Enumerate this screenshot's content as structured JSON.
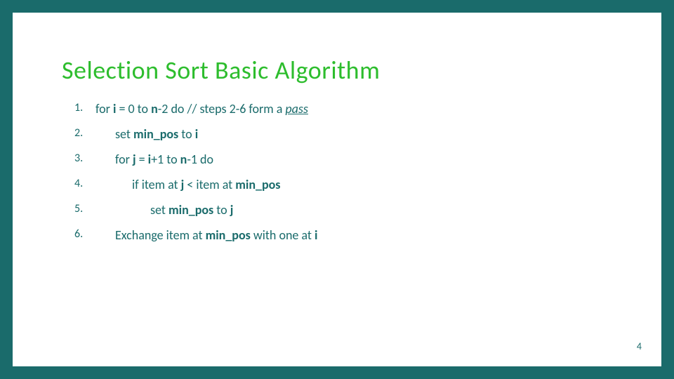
{
  "slide": {
    "title": "Selection Sort Basic Algorithm",
    "page_number": "4",
    "steps": [
      {
        "num": "1.",
        "indent": 1,
        "parts": [
          {
            "t": "for ",
            "b": false
          },
          {
            "t": "i",
            "b": true
          },
          {
            "t": " = 0 to ",
            "b": false
          },
          {
            "t": "n",
            "b": true
          },
          {
            "t": "-2 do   // steps 2-6 form a ",
            "b": false
          },
          {
            "t": "pass",
            "b": false,
            "u": true,
            "i": true
          }
        ]
      },
      {
        "num": "2.",
        "indent": 2,
        "parts": [
          {
            "t": "set ",
            "b": false
          },
          {
            "t": "min_pos",
            "b": true
          },
          {
            "t": " to ",
            "b": false
          },
          {
            "t": "i",
            "b": true
          }
        ]
      },
      {
        "num": "3.",
        "indent": 2,
        "parts": [
          {
            "t": "for ",
            "b": false
          },
          {
            "t": "j",
            "b": true
          },
          {
            "t": " = ",
            "b": false
          },
          {
            "t": "i",
            "b": true
          },
          {
            "t": "+1 to ",
            "b": false
          },
          {
            "t": "n",
            "b": true
          },
          {
            "t": "-1 do",
            "b": false
          }
        ]
      },
      {
        "num": "4.",
        "indent": 3,
        "parts": [
          {
            "t": "if item at ",
            "b": false
          },
          {
            "t": "j",
            "b": true
          },
          {
            "t": " < item at ",
            "b": false
          },
          {
            "t": "min_pos",
            "b": true
          }
        ]
      },
      {
        "num": "5.",
        "indent": 4,
        "parts": [
          {
            "t": "set ",
            "b": false
          },
          {
            "t": "min_pos",
            "b": true
          },
          {
            "t": " to ",
            "b": false
          },
          {
            "t": "j",
            "b": true
          }
        ]
      },
      {
        "num": "6.",
        "indent": 2,
        "parts": [
          {
            "t": "Exchange item at ",
            "b": false
          },
          {
            "t": "min_pos",
            "b": true
          },
          {
            "t": " with one at ",
            "b": false
          },
          {
            "t": "i",
            "b": true
          }
        ]
      }
    ]
  }
}
